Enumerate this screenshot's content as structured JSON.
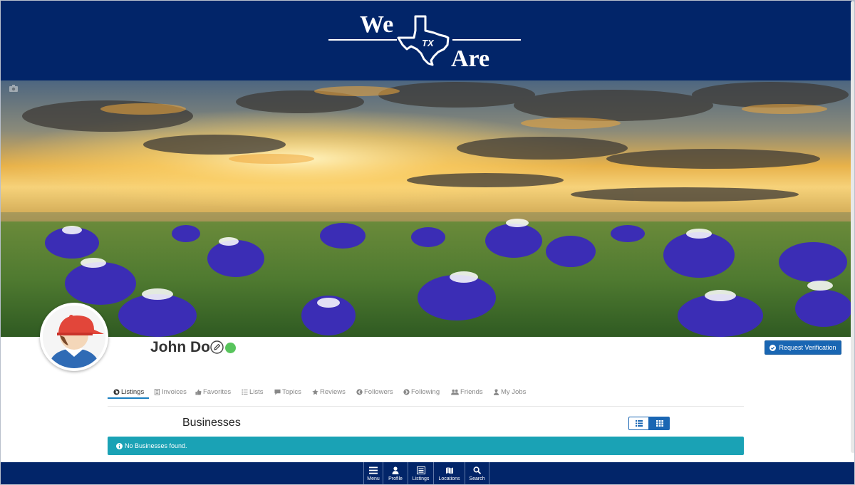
{
  "header": {
    "logo_top": "We",
    "logo_mid": "TX",
    "logo_bottom": "Are",
    "background": "#022569"
  },
  "profile": {
    "name": "John Doe",
    "online": true,
    "verify_label": "Request Verification"
  },
  "tabs": [
    {
      "label": "Listings",
      "icon": "globe-icon",
      "active": true
    },
    {
      "label": "Invoices",
      "icon": "document-icon",
      "active": false
    },
    {
      "label": "Favorites",
      "icon": "thumbs-up-icon",
      "active": false
    },
    {
      "label": "Lists",
      "icon": "list-icon",
      "active": false
    },
    {
      "label": "Topics",
      "icon": "comment-icon",
      "active": false
    },
    {
      "label": "Reviews",
      "icon": "star-icon",
      "active": false
    },
    {
      "label": "Followers",
      "icon": "arrow-left-circle-icon",
      "active": false
    },
    {
      "label": "Following",
      "icon": "arrow-right-circle-icon",
      "active": false
    },
    {
      "label": "Friends",
      "icon": "users-icon",
      "active": false
    },
    {
      "label": "My Jobs",
      "icon": "worker-icon",
      "active": false
    }
  ],
  "section": {
    "title": "Businesses",
    "empty_message": "No Businesses found."
  },
  "bottom_nav": [
    {
      "label": "Menu",
      "icon": "hamburger-icon"
    },
    {
      "label": "Profile",
      "icon": "user-icon"
    },
    {
      "label": "Listings",
      "icon": "list-box-icon"
    },
    {
      "label": "Locations",
      "icon": "map-icon"
    },
    {
      "label": "Search",
      "icon": "search-icon"
    }
  ],
  "colors": {
    "navy": "#022569",
    "accent_blue": "#1966b3",
    "info_teal": "#1aa2b5",
    "online_green": "#58c45c",
    "tab_active_underline": "#1a7fc1"
  }
}
